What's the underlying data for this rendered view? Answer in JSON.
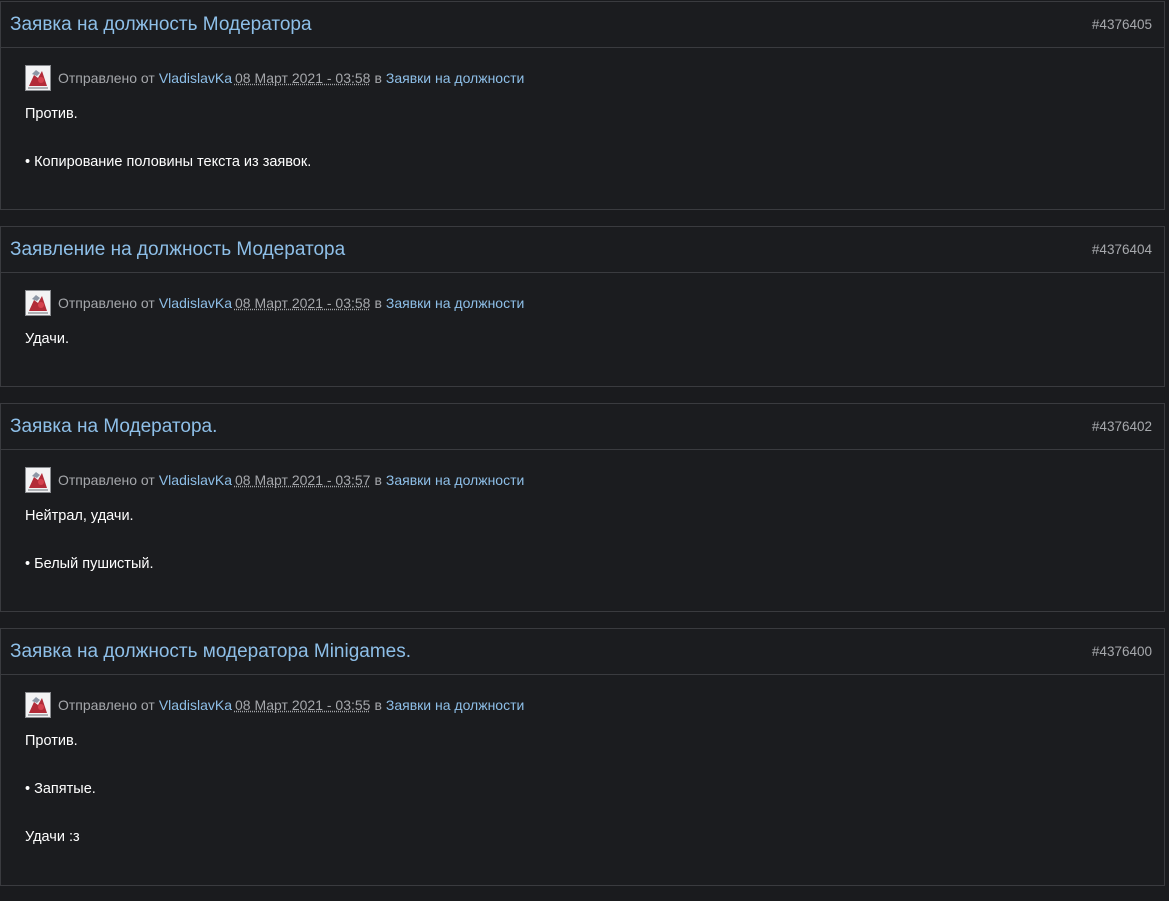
{
  "posts": [
    {
      "title": "Заявка на должность Модератора",
      "id": "#4376405",
      "meta": {
        "sent_by": "Отправлено от",
        "author": "VladislavKa",
        "date": "08 Март 2021 - 03:58",
        "in": "в",
        "forum": "Заявки на должности"
      },
      "content": [
        "Против.",
        "• Копирование половины текста из заявок."
      ]
    },
    {
      "title": "Заявление на должность Модератора",
      "id": "#4376404",
      "meta": {
        "sent_by": "Отправлено от",
        "author": "VladislavKa",
        "date": "08 Март 2021 - 03:58",
        "in": "в",
        "forum": "Заявки на должности"
      },
      "content": [
        "Удачи."
      ]
    },
    {
      "title": "Заявка на Модератора.",
      "id": "#4376402",
      "meta": {
        "sent_by": "Отправлено от",
        "author": "VladislavKa",
        "date": "08 Март 2021 - 03:57",
        "in": "в",
        "forum": "Заявки на должности"
      },
      "content": [
        "Нейтрал, удачи.",
        "• Белый пушистый."
      ]
    },
    {
      "title": "Заявка на должность модератора Minigames.",
      "id": "#4376400",
      "meta": {
        "sent_by": "Отправлено от",
        "author": "VladislavKa",
        "date": "08 Март 2021 - 03:55",
        "in": "в",
        "forum": "Заявки на должности"
      },
      "content": [
        "Против.",
        "• Запятые.",
        "Удачи :з"
      ]
    }
  ],
  "colors": {
    "background": "#1a1b1e",
    "border": "#3a3b3f",
    "link": "#8ebfe8",
    "muted": "#a5a7ab",
    "text": "#ffffff"
  },
  "icons": {
    "avatar": "user-avatar-icon"
  }
}
